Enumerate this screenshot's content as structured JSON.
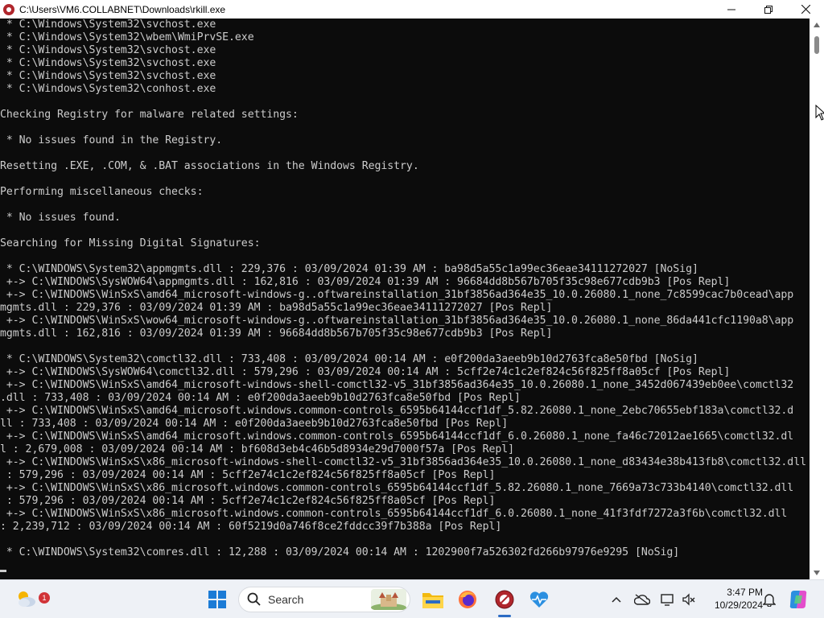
{
  "window": {
    "title": "C:\\Users\\VM6.COLLABNET\\Downloads\\rkill.exe",
    "minimize_glyph": "—",
    "maximize_glyph": "❒",
    "close_glyph": "✕"
  },
  "console": {
    "lines": [
      " * C:\\Windows\\System32\\svchost.exe",
      " * C:\\Windows\\System32\\wbem\\WmiPrvSE.exe",
      " * C:\\Windows\\System32\\svchost.exe",
      " * C:\\Windows\\System32\\svchost.exe",
      " * C:\\Windows\\System32\\svchost.exe",
      " * C:\\Windows\\System32\\conhost.exe",
      "",
      "Checking Registry for malware related settings:",
      "",
      " * No issues found in the Registry.",
      "",
      "Resetting .EXE, .COM, & .BAT associations in the Windows Registry.",
      "",
      "Performing miscellaneous checks:",
      "",
      " * No issues found.",
      "",
      "Searching for Missing Digital Signatures:",
      "",
      " * C:\\WINDOWS\\System32\\appmgmts.dll : 229,376 : 03/09/2024 01:39 AM : ba98d5a55c1a99ec36eae34111272027 [NoSig]",
      " +-> C:\\WINDOWS\\SysWOW64\\appmgmts.dll : 162,816 : 03/09/2024 01:39 AM : 96684dd8b567b705f35c98e677cdb9b3 [Pos Repl]",
      " +-> C:\\WINDOWS\\WinSxS\\amd64_microsoft-windows-g..oftwareinstallation_31bf3856ad364e35_10.0.26080.1_none_7c8599cac7b0cead\\app",
      "mgmts.dll : 229,376 : 03/09/2024 01:39 AM : ba98d5a55c1a99ec36eae34111272027 [Pos Repl]",
      " +-> C:\\WINDOWS\\WinSxS\\wow64_microsoft-windows-g..oftwareinstallation_31bf3856ad364e35_10.0.26080.1_none_86da441cfc1190a8\\app",
      "mgmts.dll : 162,816 : 03/09/2024 01:39 AM : 96684dd8b567b705f35c98e677cdb9b3 [Pos Repl]",
      "",
      " * C:\\WINDOWS\\System32\\comctl32.dll : 733,408 : 03/09/2024 00:14 AM : e0f200da3aeeb9b10d2763fca8e50fbd [NoSig]",
      " +-> C:\\WINDOWS\\SysWOW64\\comctl32.dll : 579,296 : 03/09/2024 00:14 AM : 5cff2e74c1c2ef824c56f825ff8a05cf [Pos Repl]",
      " +-> C:\\WINDOWS\\WinSxS\\amd64_microsoft-windows-shell-comctl32-v5_31bf3856ad364e35_10.0.26080.1_none_3452d067439eb0ee\\comctl32",
      ".dll : 733,408 : 03/09/2024 00:14 AM : e0f200da3aeeb9b10d2763fca8e50fbd [Pos Repl]",
      " +-> C:\\WINDOWS\\WinSxS\\amd64_microsoft.windows.common-controls_6595b64144ccf1df_5.82.26080.1_none_2ebc70655ebf183a\\comctl32.d",
      "ll : 733,408 : 03/09/2024 00:14 AM : e0f200da3aeeb9b10d2763fca8e50fbd [Pos Repl]",
      " +-> C:\\WINDOWS\\WinSxS\\amd64_microsoft.windows.common-controls_6595b64144ccf1df_6.0.26080.1_none_fa46c72012ae1665\\comctl32.dl",
      "l : 2,679,008 : 03/09/2024 00:14 AM : bf608d3eb4c46b5d8934e29d7000f57a [Pos Repl]",
      " +-> C:\\WINDOWS\\WinSxS\\x86_microsoft-windows-shell-comctl32-v5_31bf3856ad364e35_10.0.26080.1_none_d83434e38b413fb8\\comctl32.dll",
      " : 579,296 : 03/09/2024 00:14 AM : 5cff2e74c1c2ef824c56f825ff8a05cf [Pos Repl]",
      " +-> C:\\WINDOWS\\WinSxS\\x86_microsoft.windows.common-controls_6595b64144ccf1df_5.82.26080.1_none_7669a73c733b4140\\comctl32.dll",
      " : 579,296 : 03/09/2024 00:14 AM : 5cff2e74c1c2ef824c56f825ff8a05cf [Pos Repl]",
      " +-> C:\\WINDOWS\\WinSxS\\x86_microsoft.windows.common-controls_6595b64144ccf1df_6.0.26080.1_none_41f3fdf7272a3f6b\\comctl32.dll",
      ": 2,239,712 : 03/09/2024 00:14 AM : 60f5219d0a746f8ce2fddcc39f7b388a [Pos Repl]",
      "",
      " * C:\\WINDOWS\\System32\\comres.dll : 12,288 : 03/09/2024 00:14 AM : 1202900f7a526302fd266b97976e9295 [NoSig]"
    ]
  },
  "taskbar": {
    "weather_badge": "1",
    "search_placeholder": "Search",
    "clock_time": "3:47 PM",
    "clock_date": "10/29/2024",
    "apps": [
      "start-icon",
      "file-explorer-icon",
      "firefox-icon",
      "rkill-icon",
      "health-monitor-icon"
    ],
    "tray_icons": [
      "chevron-up-icon",
      "onedrive-icon",
      "network-icon",
      "volume-icon",
      "notification-bell-icon",
      "copilot-icon"
    ]
  },
  "colors": {
    "console_bg": "#0c0c0c",
    "console_fg": "#cccccc",
    "accent": "#2b6bc4"
  }
}
